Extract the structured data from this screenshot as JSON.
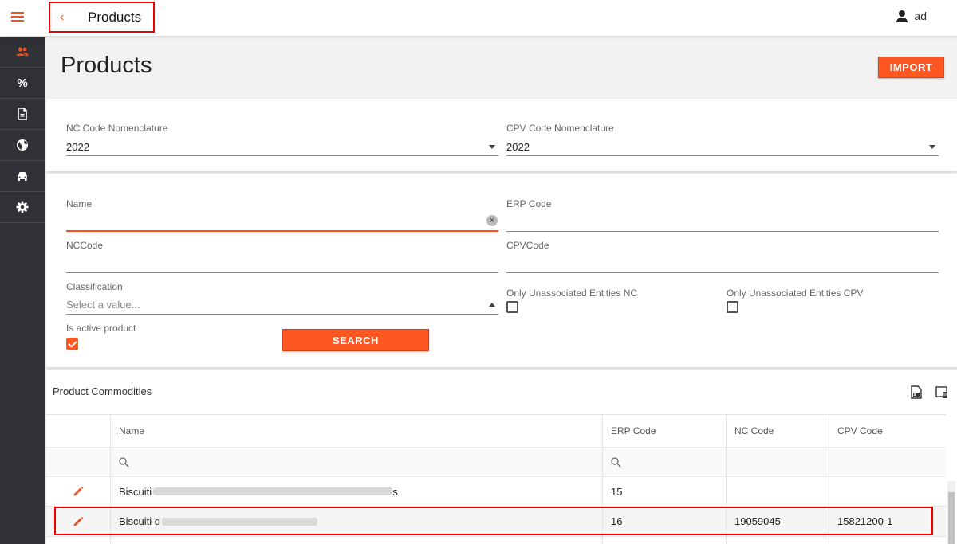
{
  "header": {
    "title": "Products",
    "user": "ad"
  },
  "sidebar": {
    "items": [
      "users-icon",
      "percent-icon",
      "document-icon",
      "globe-icon",
      "car-icon",
      "gear-icon"
    ],
    "percent_label": "%"
  },
  "page": {
    "title": "Products",
    "import_label": "IMPORT"
  },
  "nomenclature": {
    "nc": {
      "label": "NC Code Nomenclature",
      "value": "2022"
    },
    "cpv": {
      "label": "CPV Code Nomenclature",
      "value": "2022"
    }
  },
  "filters": {
    "name": {
      "label": "Name",
      "value": ""
    },
    "erp": {
      "label": "ERP Code",
      "value": ""
    },
    "nccode": {
      "label": "NCCode",
      "value": ""
    },
    "cpvcode": {
      "label": "CPVCode",
      "value": ""
    },
    "classification": {
      "label": "Classification",
      "placeholder": "Select a value..."
    },
    "only_nc": {
      "label": "Only Unassociated Entities NC",
      "checked": false
    },
    "only_cpv": {
      "label": "Only Unassociated Entities CPV",
      "checked": false
    },
    "is_active": {
      "label": "Is active product",
      "checked": true
    },
    "search_label": "SEARCH"
  },
  "grid": {
    "title": "Product Commodities",
    "columns": [
      "Name",
      "ERP Code",
      "NC Code",
      "CPV Code"
    ],
    "rows": [
      {
        "name": "Biscuiti",
        "name_tail": "s",
        "erp": "15",
        "nc": "",
        "cpv": ""
      },
      {
        "name": "Biscuiti d",
        "erp": "16",
        "nc": "19059045",
        "cpv": "15821200-1"
      }
    ]
  },
  "colors": {
    "accent": "#ff5722",
    "sidebar": "#2f3136",
    "highlight": "#ee0000"
  }
}
